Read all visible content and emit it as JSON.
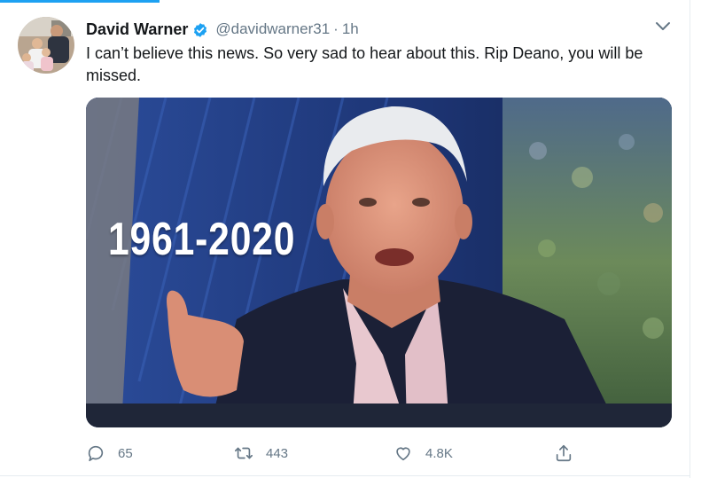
{
  "tweet": {
    "display_name": "David Warner",
    "handle": "@davidwarner31",
    "separator": "·",
    "time": "1h",
    "text": "I can’t believe this news. So very sad to hear about this. Rip Deano, you will be missed."
  },
  "media": {
    "caption": "1961-2020"
  },
  "actions": {
    "reply_count": "65",
    "retweet_count": "443",
    "like_count": "4.8K"
  },
  "icons": {
    "verified": "verified-badge-icon",
    "caret": "chevron-down-icon",
    "reply": "reply-icon",
    "retweet": "retweet-icon",
    "like": "heart-icon",
    "share": "share-icon"
  },
  "colors": {
    "accent": "#1da1f2",
    "text_primary": "#14171a",
    "text_secondary": "#657786"
  }
}
